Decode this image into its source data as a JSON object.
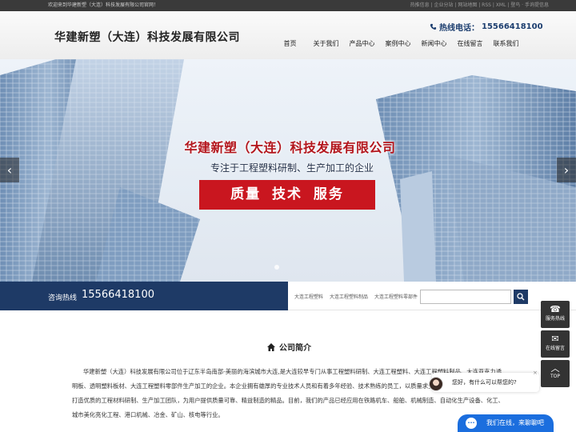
{
  "topbar": {
    "welcome": "欢迎来到华建新塑（大连）科技发展有限公司官网！",
    "links": "热推信息 | 企业分站 | 网站地图 | RSS | XML | 登鸟 · 手询提信息"
  },
  "header": {
    "company_name": "华建新塑（大连）科技发展有限公司",
    "hotline_label": "热线电话：",
    "hotline_number": "15566418100"
  },
  "nav": [
    {
      "label": "首页"
    },
    {
      "label": "关于我们"
    },
    {
      "label": "产品中心"
    },
    {
      "label": "案例中心"
    },
    {
      "label": "新闻中心"
    },
    {
      "label": "在线留言"
    },
    {
      "label": "联系我们"
    }
  ],
  "banner": {
    "title": "华建新塑（大连）科技发展有限公司",
    "subtitle": "专注于工程塑料研制、生产加工的企业",
    "box_text": "质量  技术  服务",
    "prev": "‹",
    "next": "›"
  },
  "infobar": {
    "hotline_label": "咨询热线",
    "hotline_number": "15566418100",
    "tags": [
      "大连工程塑料",
      "大连工程塑料制品",
      "大连工程塑料零部件"
    ],
    "search_value": ""
  },
  "about": {
    "heading": "公司简介",
    "body": "华建新塑（大连）科技发展有限公司位于辽东半岛南部-美丽的海滨城市大连,是大连较早专门从事工程塑料研制、大连工程塑料、大连工程塑料制品、大连亚克力透明板、透明塑料板材、大连工程塑料零部件生产加工的企业。本企业拥有雄厚的专业技术人员和有着多年经验、技术熟练的员工，以质量求生存，以信为本的宗旨，全力打造优质的工程材料研制、生产加工团队，为用户提供质量可靠、精益制造的精品。目前，我们的产品已经应用在铁路机车、船舶、机械制造、自动化生产设备、化工、城市美化亮化工程、港口机械、冶金、矿山、核电等行业。"
  },
  "float": {
    "service": "服务热线",
    "message": "在线留言",
    "top": "TOP"
  },
  "chat": {
    "greeting": "您好，有什么可以帮您的?",
    "bar_text": "我们在线，来聊聊吧",
    "close": "×"
  },
  "colors": {
    "navy": "#1e3a66",
    "red": "#c9161f",
    "chat_blue": "#1b6ede"
  }
}
